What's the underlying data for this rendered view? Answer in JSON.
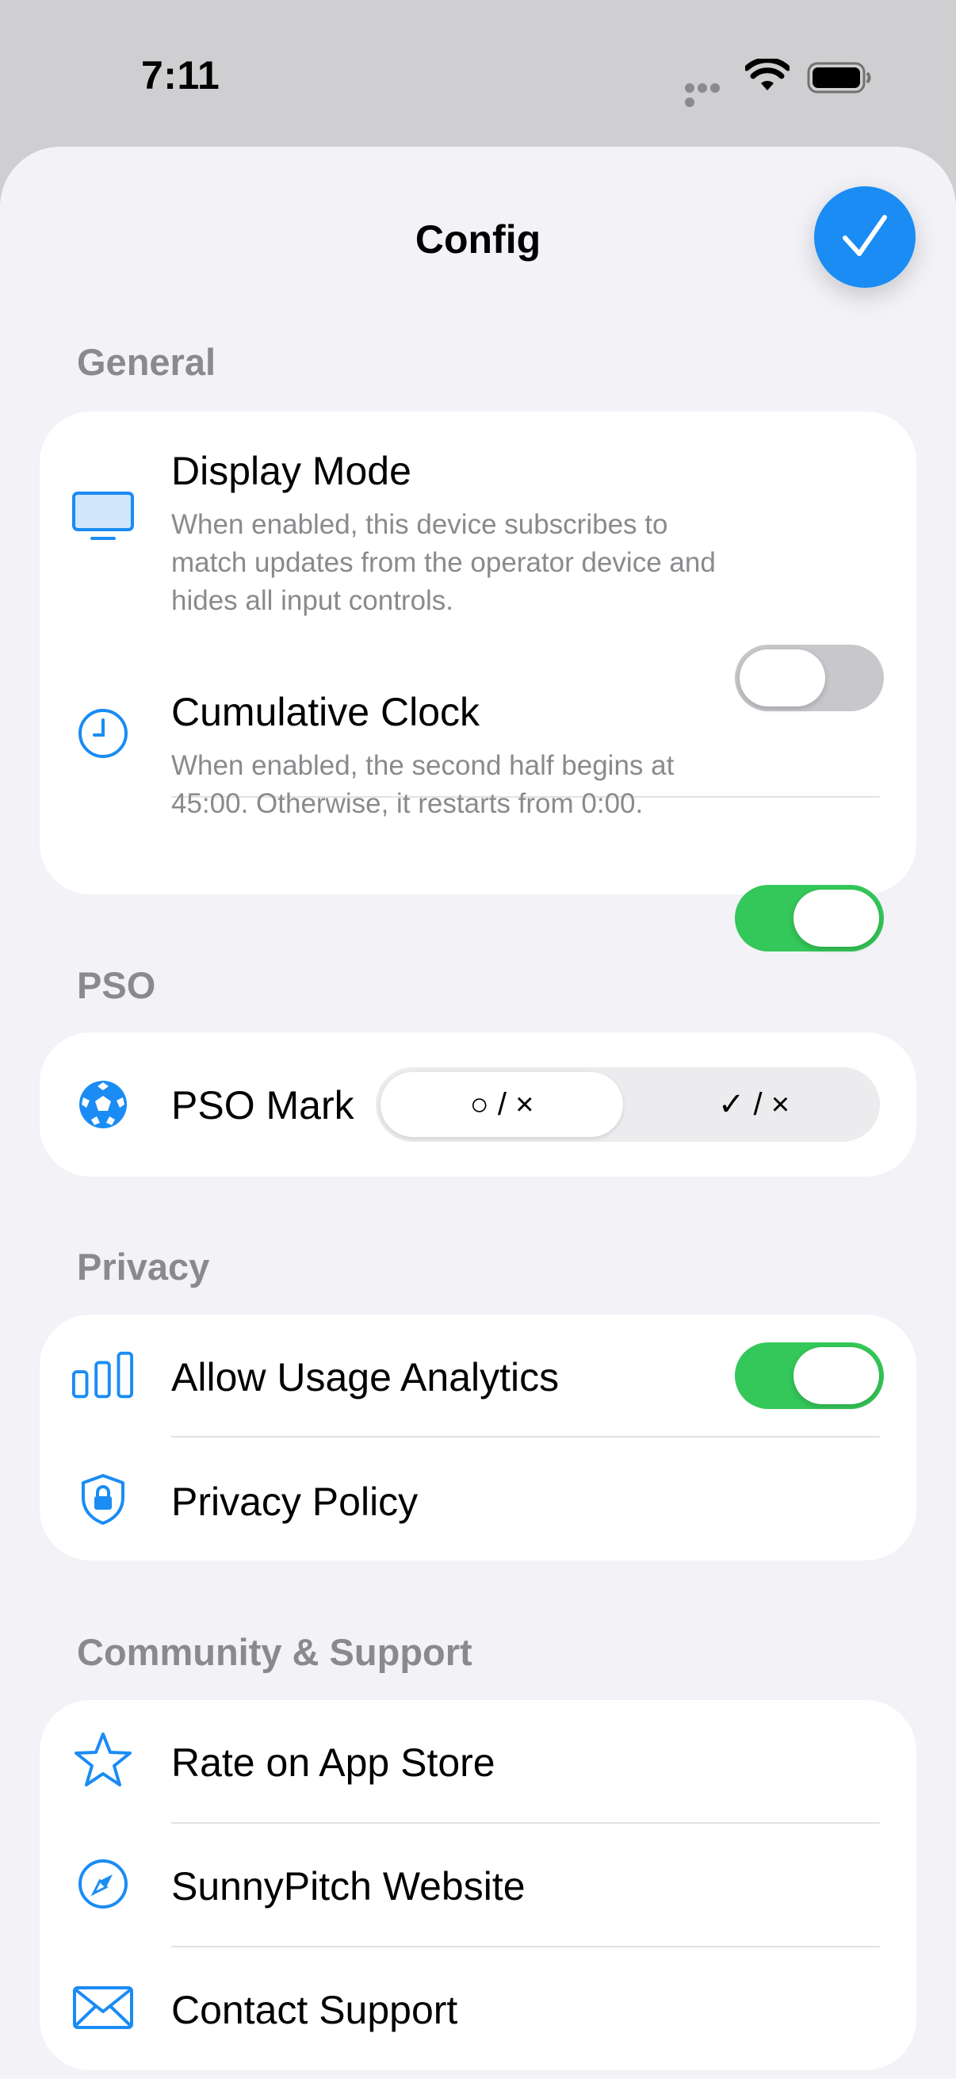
{
  "status_bar": {
    "time": "7:11"
  },
  "sheet": {
    "title": "Config",
    "done_icon": "checkmark-icon",
    "accent_color": "#1a8cf4"
  },
  "general": {
    "header": "General",
    "display_mode": {
      "title": "Display Mode",
      "description": "When enabled, this device subscribes to match updates from the operator device and hides all input controls.",
      "enabled": false,
      "icon": "monitor-icon"
    },
    "cumulative_clock": {
      "title": "Cumulative Clock",
      "description": "When enabled, the second half begins at 45:00. Otherwise, it restarts from 0:00.",
      "enabled": true,
      "icon": "clock-icon"
    }
  },
  "pso": {
    "header": "PSO",
    "mark": {
      "title": "PSO Mark",
      "icon": "soccer-ball-icon",
      "options": [
        "○ / ×",
        "✓ / ×"
      ],
      "selected": "○ / ×"
    }
  },
  "privacy": {
    "header": "Privacy",
    "analytics": {
      "title": "Allow Usage Analytics",
      "enabled": true,
      "icon": "chart-bars-icon"
    },
    "policy": {
      "title": "Privacy Policy",
      "icon": "shield-lock-icon"
    }
  },
  "community": {
    "header": "Community & Support",
    "rate": {
      "title": "Rate on App Store",
      "icon": "star-icon"
    },
    "website": {
      "title": "SunnyPitch Website",
      "icon": "compass-icon"
    },
    "contact": {
      "title": "Contact Support",
      "icon": "envelope-icon"
    }
  },
  "colors": {
    "toggle_on": "#34c759",
    "toggle_off": "#c8c8cc",
    "icon_blue": "#1a8cf4",
    "background": "#f2f2f7"
  }
}
